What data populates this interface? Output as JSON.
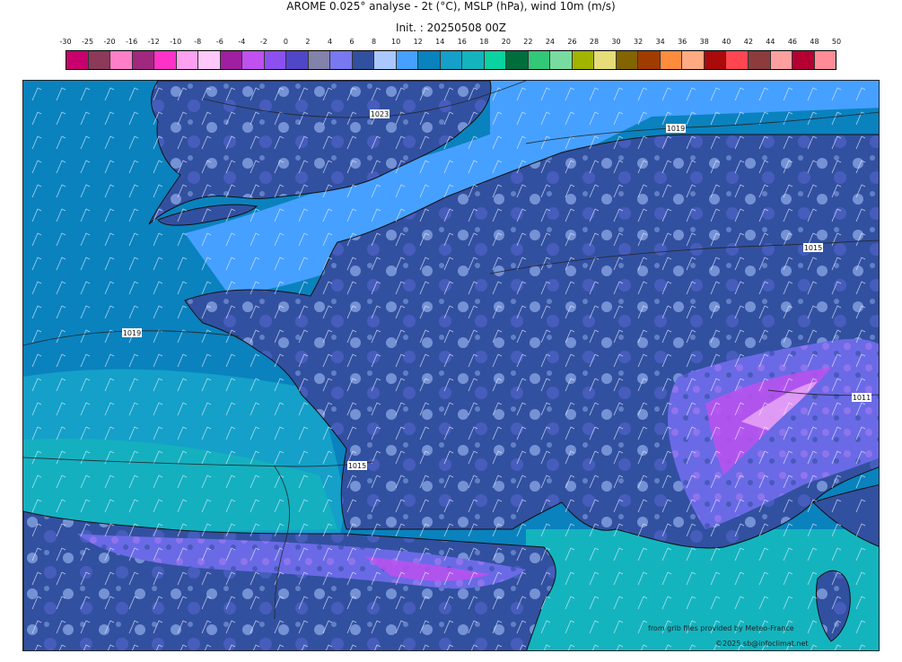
{
  "header": {
    "title": "AROME 0.025° analyse - 2t (°C), MSLP (hPa), wind 10m (m/s)",
    "init": "Init. : 20250508 00Z"
  },
  "legend": {
    "labels": [
      "-30",
      "-25",
      "-20",
      "-16",
      "-12",
      "-10",
      "-8",
      "-6",
      "-4",
      "-2",
      "0",
      "2",
      "4",
      "6",
      "8",
      "10",
      "12",
      "14",
      "16",
      "18",
      "20",
      "22",
      "24",
      "26",
      "28",
      "30",
      "32",
      "34",
      "36",
      "38",
      "40",
      "42",
      "44",
      "46",
      "48",
      "50"
    ],
    "colors": [
      "#c8006e",
      "#8c3a5a",
      "#ff7ec8",
      "#a0287e",
      "#ff32c8",
      "#ffa0f0",
      "#ffc8fa",
      "#a01ea0",
      "#c050f0",
      "#8c50f0",
      "#5046c8",
      "#8282aa",
      "#7878f0",
      "#3250a0",
      "#aac8ff",
      "#46a0ff",
      "#0a82be",
      "#14a0c8",
      "#14b4be",
      "#0ad2a0",
      "#006e3c",
      "#32c878",
      "#78dca0",
      "#a0b400",
      "#e6dc78",
      "#826400",
      "#a03c00",
      "#ff8c3c",
      "#ffaa82",
      "#aa0a0a",
      "#ff4650",
      "#8c3c3c",
      "#ffa0a0",
      "#b40032",
      "#ff8c96"
    ]
  },
  "isobars": {
    "labels": [
      "1023",
      "1019",
      "1015",
      "1019",
      "1015",
      "1011"
    ]
  },
  "credits": {
    "source": "from grib files provided by Meteo-France",
    "copyright": "©2025 sb@infoclimat.net"
  },
  "colors": {
    "sea_atlantic": "#0a82be",
    "sea_med": "#14b4be",
    "land_cool": "#3250a0",
    "land_mild": "#aac8ff",
    "channel": "#46a0ff",
    "mountains": "#7878f0",
    "alps_peak": "#c050f0"
  }
}
